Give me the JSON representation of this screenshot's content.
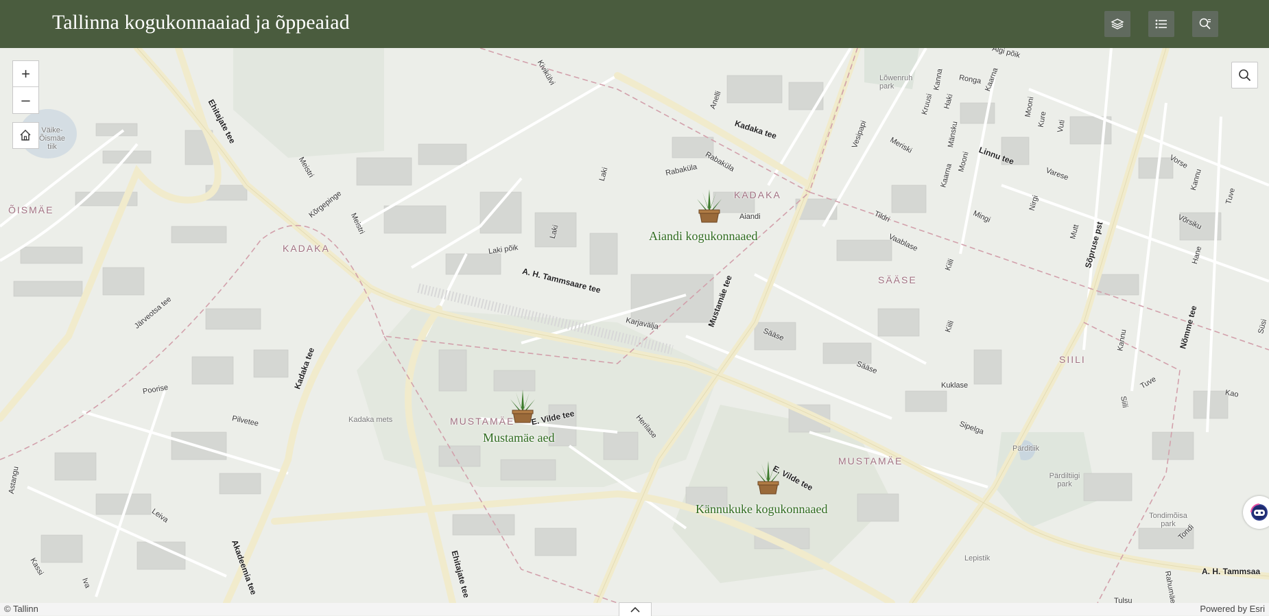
{
  "header": {
    "title": "Tallinna kogukonnaaiad ja õppeaiad",
    "layers_icon": "layers-icon",
    "legend_icon": "list-icon",
    "query_icon": "search-list-icon"
  },
  "map": {
    "zoom_in_label": "+",
    "zoom_out_label": "–",
    "home_icon": "home-icon",
    "search_icon": "search-icon",
    "gardens": [
      {
        "name": "Aiandi kogukonnaaed"
      },
      {
        "name": "Mustamäe aed"
      },
      {
        "name": "Kännukuke kogukonnaaed"
      }
    ],
    "districts": [
      "ÕISMÄE",
      "KADAKA",
      "KADAKA",
      "SÄÄSE",
      "SIILI",
      "MUSTAMÄE",
      "MUSTAMÄE"
    ],
    "streets": [
      "Ehitajate tee",
      "Kadaka tee",
      "A. H. Tammsaare tee",
      "Mustamäe tee",
      "E. Vilde tee",
      "E. Vilde tee",
      "Sõpruse pst",
      "Linnu tee",
      "Nõmme tee",
      "Kadaka tee",
      "Ehitajate tee",
      "Akadeemia tee",
      "A. H. Tammsaa"
    ],
    "minor_streets": [
      "Meistri",
      "Meistri",
      "Kõrgepinge",
      "Järveotsa tee",
      "Poorise",
      "Pilvetee",
      "Astangu",
      "Leiva",
      "Kassi",
      "Iva",
      "Laki",
      "Laki",
      "Laki põik",
      "Karjavälja",
      "Rabaküla",
      "Rabaküla",
      "Aiandi",
      "Anelli",
      "Kivikülvi",
      "Vaablase",
      "Tildri",
      "Kiili",
      "Kiili",
      "Sääse",
      "Sääse",
      "Kuklase",
      "Sipelga",
      "Herilase",
      "Vesipapi",
      "Meriski",
      "Kaarna",
      "Mooni",
      "Kure",
      "Vuti",
      "Varese",
      "Mingi",
      "Nirgi",
      "Mutt",
      "Kanna",
      "Haki",
      "Ronga",
      "Algi põik",
      "Kruusi",
      "Kaarna",
      "Mooni",
      "Mänsku",
      "Vorse",
      "Kannu",
      "Võrsiku",
      "Tuve",
      "Hane",
      "Tuve",
      "Kao",
      "Siili",
      "Kannu",
      "Tondi",
      "Rahumäe",
      "Tulsu",
      "Lepistik",
      "Süsi"
    ],
    "places": [
      "Väike-Õismäe tiik",
      "Kadaka mets",
      "Lõwenruh park",
      "Pärditiik",
      "Pärdiltiigi park",
      "Tondimõisa park"
    ]
  },
  "footer": {
    "attribution_left": "© Tallinn",
    "attribution_right": "Powered by Esri"
  },
  "assistant_icon": "assistant-icon",
  "collapse_icon": "chevron-up-icon"
}
